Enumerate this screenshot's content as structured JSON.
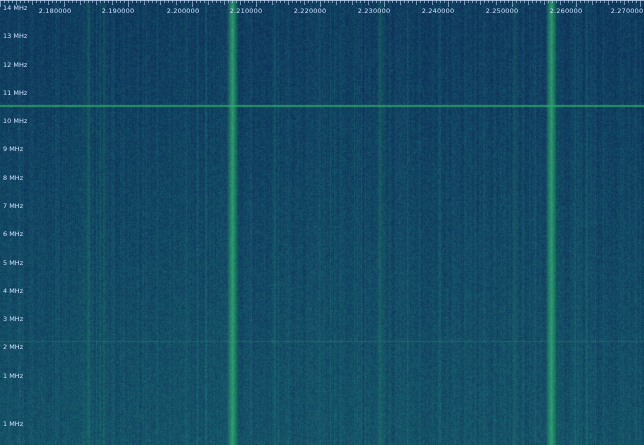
{
  "frequency_axis": {
    "labels": [
      "2.180000",
      "2.190000",
      "2.200000",
      "2.210000",
      "2.220000",
      "2.230000",
      "2.240000",
      "2.250000",
      "2.260000",
      "2.270000"
    ]
  },
  "time_axis": {
    "labels": [
      "14 MHz",
      "13 MHz",
      "12 MHz",
      "11 MHz",
      "10 MHz",
      "9 MHz",
      "8 MHz",
      "7 MHz",
      "6 MHz",
      "5 MHz",
      "4 MHz",
      "3 MHz",
      "2 MHz",
      "1 MHz",
      "1 MHz"
    ]
  },
  "colors": {
    "background": "#0f2a4d",
    "noise_low": "#0d2f5a",
    "noise_high": "#1f7a78",
    "signal": "#2fb06a",
    "label": "#cfe3ff"
  }
}
